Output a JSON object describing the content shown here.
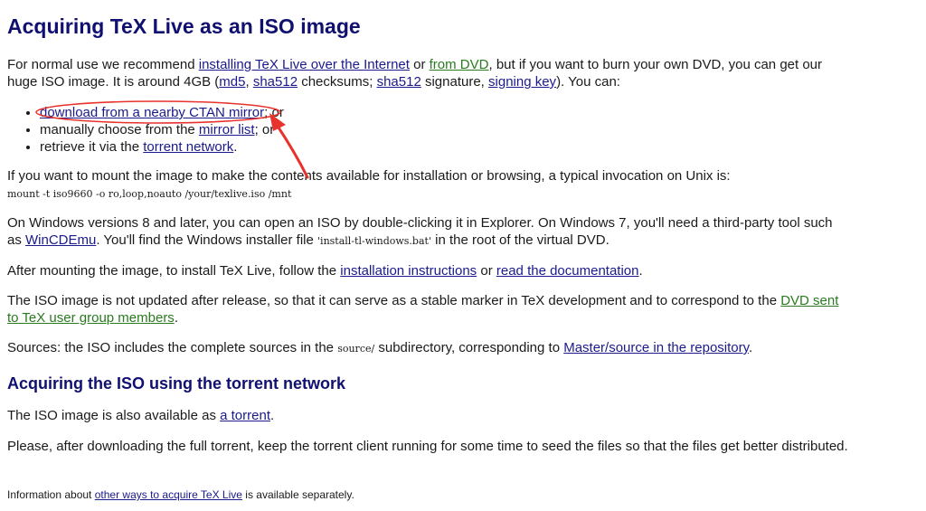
{
  "title": "Acquiring TeX Live as an ISO image",
  "intro": {
    "t1": "For normal use we recommend ",
    "link_install_internet": "installing TeX Live over the Internet",
    "t2": " or ",
    "link_from_dvd": "from DVD",
    "t3": ", but if you want to burn your own DVD, you can get our huge ISO image. It is around 4GB (",
    "link_md5": "md5",
    "t4": ", ",
    "link_sha512": "sha512",
    "t5": " checksums; ",
    "link_sha512_sig": "sha512",
    "t6": " signature, ",
    "link_signing_key": "signing key",
    "t7": "). You can:"
  },
  "options": [
    {
      "link": "download from a nearby CTAN mirror",
      "suffix": "; or"
    },
    {
      "prefix": "manually choose from the ",
      "link": "mirror list",
      "suffix": "; or"
    },
    {
      "prefix": "retrieve it via the ",
      "link": "torrent network",
      "suffix": "."
    }
  ],
  "mount_text": "If you want to mount the image to make the contents available for installation or browsing, a typical invocation on Unix is:",
  "mount_cmd": "mount  -t  iso9660  -o  ro,loop,noauto  /your/texlive.iso  /mnt",
  "windows": {
    "t1": "On Windows versions 8 and later, you can open an ISO by double-clicking it in Explorer. On Windows 7, you'll need a third-party tool such as ",
    "link_wincdemu": "WinCDEmu",
    "t2": ". You'll find the Windows installer file ",
    "code": "'install-tl-windows.bat'",
    "t3": " in the root of the virtual DVD."
  },
  "after": {
    "t1": "After mounting the image, to install TeX Live, follow the ",
    "link_install_instr": "installation instructions",
    "t2": " or ",
    "link_read_doc": "read the documentation",
    "t3": "."
  },
  "notupdated": {
    "t1": "The ISO image is not updated after release, so that it can serve as a stable marker in TeX development and to correspond to the ",
    "link_dvd_members": "DVD sent to TeX user group members",
    "t2": "."
  },
  "sources": {
    "t1": "Sources: the ISO includes the complete sources in the ",
    "code": "source/",
    "t2": " subdirectory, corresponding to ",
    "link_master_source": "Master/source in the repository",
    "t3": "."
  },
  "torrent_heading": "Acquiring the ISO using the torrent network",
  "torrent_avail": {
    "t1": "The ISO image is also available as ",
    "link_torrent": "a torrent",
    "t2": "."
  },
  "torrent_please": "Please, after downloading the full torrent, keep the torrent client running for some time to seed the files so that the files get better distributed.",
  "footer": {
    "t1": "Information about ",
    "link_other_ways": "other ways to acquire TeX Live",
    "t2": " is available separately."
  },
  "colors": {
    "heading": "#101070",
    "link_blue": "#1a1a8c",
    "link_green": "#2a7a1f",
    "annotation_red": "#e8322c"
  }
}
